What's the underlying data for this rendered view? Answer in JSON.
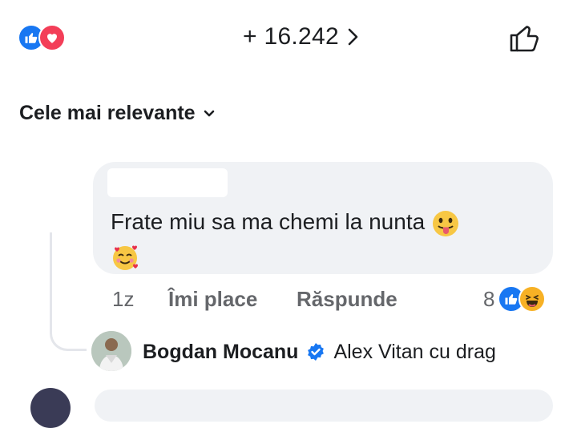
{
  "header": {
    "reaction_icons": [
      "like-reaction-icon",
      "love-reaction-icon"
    ],
    "reaction_count": "+ 16.242",
    "like_icon": "thumbs-up-outline-icon"
  },
  "sort": {
    "label": "Cele mai relevante"
  },
  "comment": {
    "text": "Frate miu sa ma chemi la nunta",
    "emojis": [
      "tongue-out-emoji",
      "smiling-hearts-emoji"
    ],
    "time": "1z",
    "like_label": "Îmi place",
    "reply_label": "Răspunde",
    "reactions_count": "8",
    "reaction_icons": [
      "like-reaction-icon",
      "haha-reaction-icon"
    ]
  },
  "reply": {
    "author": "Bogdan Mocanu",
    "verified": true,
    "text": "Alex Vitan cu drag"
  },
  "colors": {
    "facebook_blue": "#1877f2",
    "love_red": "#f33e58",
    "haha_yellow": "#f7b125",
    "bubble_gray": "#f0f2f5",
    "meta_text": "#65676b"
  }
}
